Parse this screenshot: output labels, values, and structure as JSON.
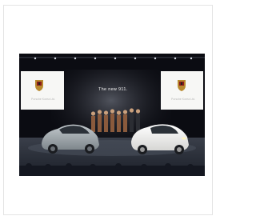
{
  "image": {
    "alt": "",
    "stage_title": "The new 911.",
    "screen_caption_left": "Porsche Korea Ltd.",
    "screen_caption_right": "Porsche Korea Ltd."
  },
  "colors": {
    "background": "#ffffff",
    "border": "#e3e3e3",
    "stage_dark": "#0b0c12",
    "car_left": "#9aa3a8",
    "car_right": "#f4f4f2"
  }
}
